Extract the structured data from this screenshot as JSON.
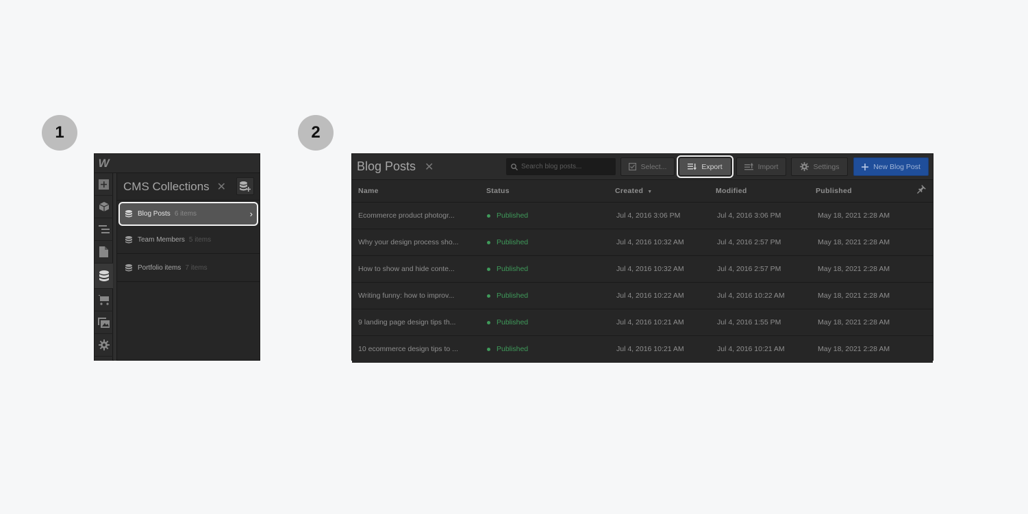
{
  "steps": [
    "1",
    "2"
  ],
  "panel1": {
    "logo": "W",
    "rail_icons": [
      "add-icon",
      "box-icon",
      "navigator-icon",
      "pages-icon",
      "cms-icon",
      "ecommerce-icon",
      "assets-icon",
      "settings-icon"
    ],
    "active_rail": "cms-icon",
    "title": "CMS Collections",
    "close_label": "✕",
    "collections": [
      {
        "name": "Blog Posts",
        "count": "6 items",
        "selected": true
      },
      {
        "name": "Team Members",
        "count": "5 items",
        "selected": false
      },
      {
        "name": "Portfolio items",
        "count": "7 items",
        "selected": false
      }
    ]
  },
  "panel2": {
    "title": "Blog Posts",
    "close_label": "✕",
    "search": {
      "placeholder": "Search blog posts...",
      "value": ""
    },
    "toolbar": {
      "select_label": "Select...",
      "export_label": "Export",
      "import_label": "Import",
      "settings_label": "Settings",
      "new_label": "New Blog Post"
    },
    "colors": {
      "primary": "#1f4e9a",
      "published": "#3f9a5a"
    },
    "columns": {
      "name": "Name",
      "status": "Status",
      "created": "Created",
      "modified": "Modified",
      "published": "Published"
    },
    "sort_indicator": "▼",
    "rows": [
      {
        "name": "Ecommerce product photogr...",
        "status": "Published",
        "created": "Jul 4, 2016 3:06 PM",
        "modified": "Jul 4, 2016 3:06 PM",
        "published": "May 18, 2021 2:28 AM"
      },
      {
        "name": "Why your design process sho...",
        "status": "Published",
        "created": "Jul 4, 2016 10:32 AM",
        "modified": "Jul 4, 2016 2:57 PM",
        "published": "May 18, 2021 2:28 AM"
      },
      {
        "name": "How to show and hide conte...",
        "status": "Published",
        "created": "Jul 4, 2016 10:32 AM",
        "modified": "Jul 4, 2016 2:57 PM",
        "published": "May 18, 2021 2:28 AM"
      },
      {
        "name": "Writing funny: how to improv...",
        "status": "Published",
        "created": "Jul 4, 2016 10:22 AM",
        "modified": "Jul 4, 2016 10:22 AM",
        "published": "May 18, 2021 2:28 AM"
      },
      {
        "name": "9 landing page design tips th...",
        "status": "Published",
        "created": "Jul 4, 2016 10:21 AM",
        "modified": "Jul 4, 2016 1:55 PM",
        "published": "May 18, 2021 2:28 AM"
      },
      {
        "name": "10 ecommerce design tips to ...",
        "status": "Published",
        "created": "Jul 4, 2016 10:21 AM",
        "modified": "Jul 4, 2016 10:21 AM",
        "published": "May 18, 2021 2:28 AM"
      }
    ]
  }
}
